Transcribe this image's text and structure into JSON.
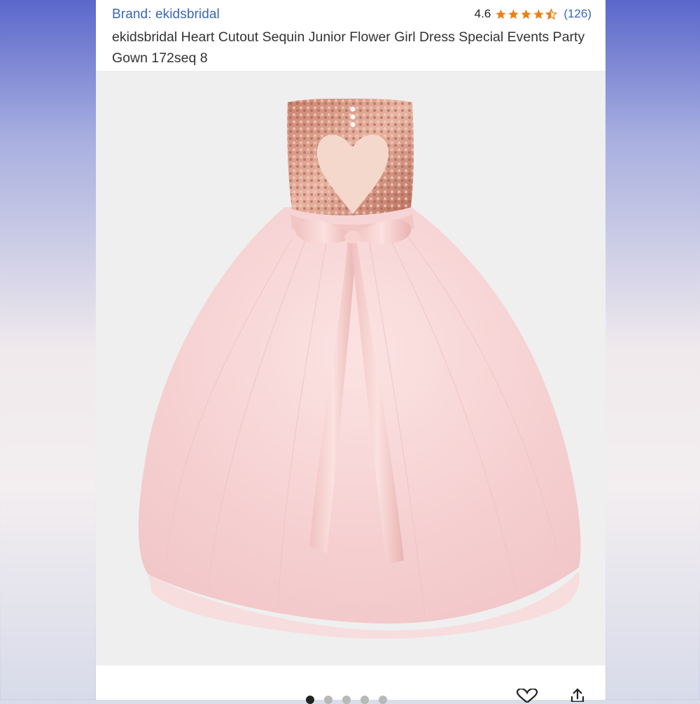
{
  "product": {
    "brand": "Brand: ekidsbridal",
    "title": "ekidsbridal Heart Cutout Sequin Junior Flower Girl Dress Special Events Party Gown 172seq 8",
    "rating_value": "4.6",
    "rating_stars": 4.6,
    "rating_count": "(126)"
  },
  "gallery": {
    "image_alt": "Blush pink sequin heart cutout flower girl dress",
    "dots_total": 5,
    "active_index": 0
  },
  "icons": {
    "star": "star-icon",
    "heart": "heart-icon",
    "share": "share-icon"
  },
  "colors": {
    "link": "#3a66b7",
    "star": "#e8811a",
    "text": "#333333"
  }
}
